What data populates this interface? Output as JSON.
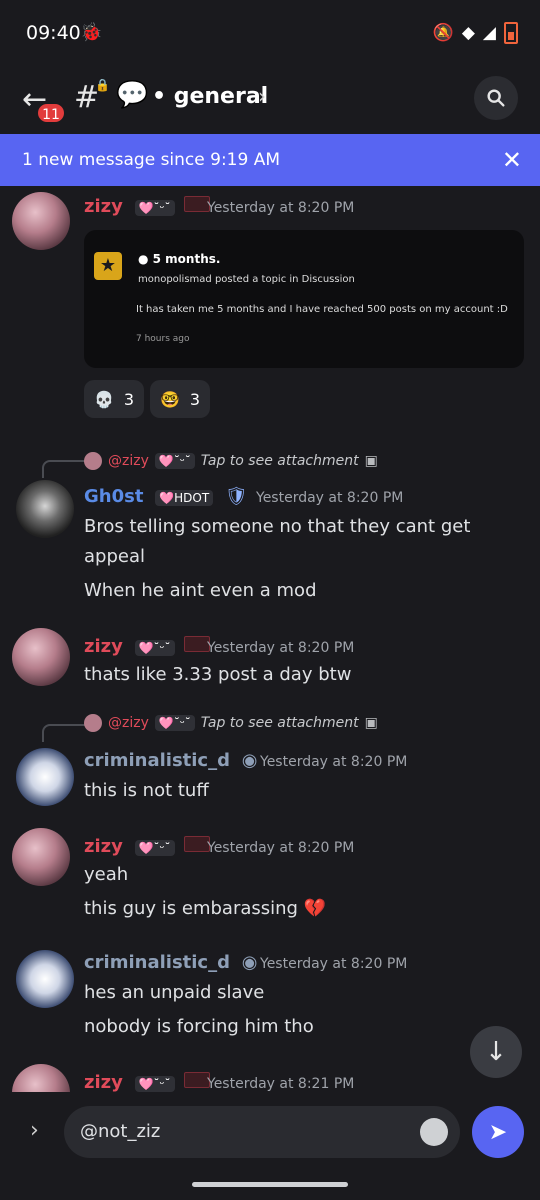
{
  "status": {
    "time": "09:40",
    "bug_icon": "bug-icon",
    "mute_icon": "mute-icon",
    "wifi_icon": "wifi-icon",
    "signal_icon": "signal-icon",
    "battery_icon": "battery-icon"
  },
  "header": {
    "back_icon": "arrow-left-icon",
    "unread_badge": "11",
    "hash_icon": "#",
    "bubble_icon": "💬",
    "channel_name": "• general",
    "chevron_icon": "›",
    "search_icon": "search-icon"
  },
  "banner": {
    "text": "1 new message since 9:19 AM",
    "close": "✕"
  },
  "messages": [
    {
      "author": "zizy",
      "badge": "🩷˘ᵕ˘",
      "timestamp": "Yesterday at 8:20 PM",
      "embed": {
        "title": "● 5 months.",
        "subtitle": "monopolismad posted a topic in Discussion",
        "body": "It has taken me 5 months and I have reached 500 posts on my account :D",
        "time": "7 hours ago"
      },
      "reactions": [
        {
          "emoji": "💀",
          "count": "3"
        },
        {
          "emoji": "🤓",
          "count": "3"
        }
      ]
    },
    {
      "reply_to": "@zizy",
      "reply_badge": "🩷˘ᵕ˘",
      "reply_text": "Tap to see attachment",
      "author": "Gh0st",
      "badge": "🩷HDOT",
      "shield": "🛡",
      "timestamp": "Yesterday at 8:20 PM",
      "lines": [
        "Bros telling someone no that they cant get",
        "appeal",
        "When he aint even a mod"
      ]
    },
    {
      "author": "zizy",
      "badge": "🩷˘ᵕ˘",
      "timestamp": "Yesterday at 8:20 PM",
      "lines": [
        "thats like 3.33 post a day btw"
      ]
    },
    {
      "reply_to": "@zizy",
      "reply_badge": "🩷˘ᵕ˘",
      "reply_text": "Tap to see attachment",
      "author": "criminalistic_d",
      "timestamp": "Yesterday at 8:20 PM",
      "lines": [
        "this is not tuff"
      ]
    },
    {
      "author": "zizy",
      "badge": "🩷˘ᵕ˘",
      "timestamp": "Yesterday at 8:20 PM",
      "lines": [
        "yeah",
        "this guy is embarassing 💔"
      ]
    },
    {
      "author": "criminalistic_d",
      "timestamp": "Yesterday at 8:20 PM",
      "lines": [
        "hes an unpaid slave",
        "nobody is forcing him tho"
      ]
    },
    {
      "author": "zizy",
      "badge": "🩷˘ᵕ˘",
      "timestamp": "Yesterday at 8:21 PM"
    }
  ],
  "composer": {
    "chevron_icon": "›",
    "value": "@not_ziz",
    "emoji_icon": "emoji-icon",
    "send_icon": "send-icon"
  }
}
